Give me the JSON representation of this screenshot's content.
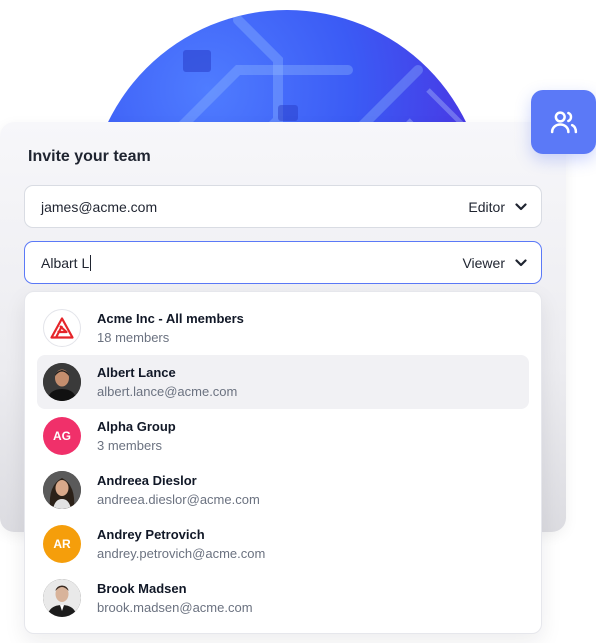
{
  "colors": {
    "accent": "#5b79f7",
    "active_border": "#5b79f7",
    "alpha_group": "#f0306a",
    "andrey_petrovich": "#f59e0b",
    "acme_logo": "#e5252a"
  },
  "team_icon": "users-icon",
  "invite": {
    "title": "Invite your team",
    "rows": [
      {
        "value": "james@acme.com",
        "role": "Editor",
        "chevron": "chevron-down-icon"
      },
      {
        "value": "Albart L",
        "role": "Viewer",
        "chevron": "chevron-down-icon"
      }
    ]
  },
  "suggestions": [
    {
      "name": "Acme Inc - All members",
      "sub": "18 members",
      "avatar": "acme-logo"
    },
    {
      "name": "Albert Lance",
      "sub": "albert.lance@acme.com",
      "avatar": "photo",
      "highlighted": true
    },
    {
      "name": "Alpha Group",
      "sub": "3 members",
      "avatar": "AG"
    },
    {
      "name": "Andreea Dieslor",
      "sub": "andreea.dieslor@acme.com",
      "avatar": "photo"
    },
    {
      "name": "Andrey Petrovich",
      "sub": "andrey.petrovich@acme.com",
      "avatar": "AR"
    },
    {
      "name": "Brook Madsen",
      "sub": "brook.madsen@acme.com",
      "avatar": "photo"
    }
  ]
}
